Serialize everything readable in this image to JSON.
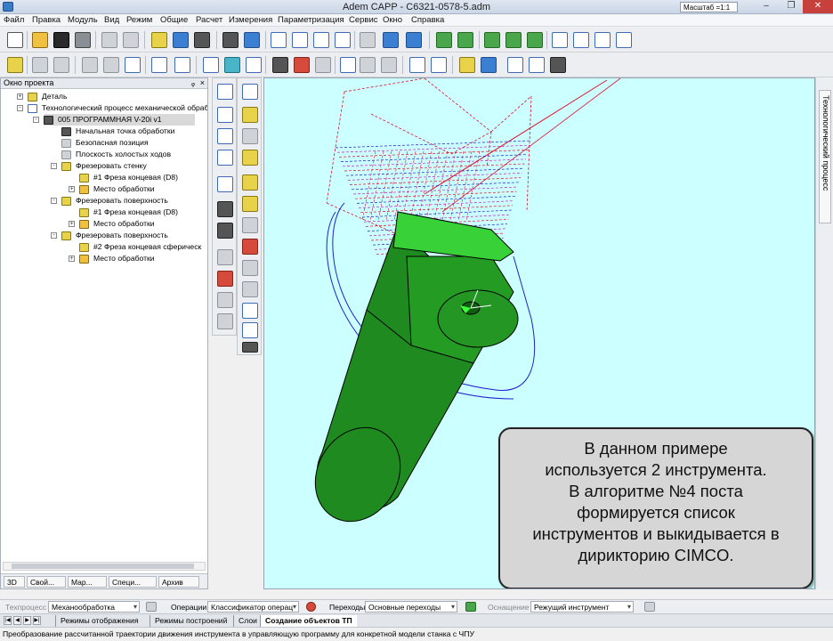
{
  "window": {
    "title": "Adem CAPP - C6321-0578-5.adm",
    "scale_label": "Масштаб =1:1",
    "minimize": "–",
    "maximize": "❐",
    "close": "✕"
  },
  "menu": [
    "Файл",
    "Правка",
    "Модуль",
    "Вид",
    "Режим",
    "Общие",
    "Расчет",
    "Измерения",
    "Параметризация",
    "Сервис",
    "Окно",
    "Справка"
  ],
  "project": {
    "header": "Окно проекта",
    "pin": "ᵩ",
    "close": "×",
    "tree": [
      {
        "label": "Деталь",
        "level": 0,
        "expander": "+"
      },
      {
        "label": "Технологический процесс механической обработ",
        "level": 0,
        "expander": "-"
      },
      {
        "label": "005  ПРОГРАММНАЯ V-20i v1",
        "level": 1,
        "expander": "-",
        "selected": true
      },
      {
        "label": "Начальная точка обработки",
        "level": 2
      },
      {
        "label": "Безопасная позиция",
        "level": 2
      },
      {
        "label": "Плоскость холостых ходов",
        "level": 2
      },
      {
        "label": "Фрезеровать стенку",
        "level": 2,
        "expander": "-"
      },
      {
        "label": "#1 Фреза концевая (D8)",
        "level": 3
      },
      {
        "label": "Место обработки",
        "level": 3,
        "expander": "+"
      },
      {
        "label": "Фрезеровать поверхность",
        "level": 2,
        "expander": "-"
      },
      {
        "label": "#1 Фреза концевая (D8)",
        "level": 3
      },
      {
        "label": "Место обработки",
        "level": 3,
        "expander": "+"
      },
      {
        "label": "Фрезеровать поверхность",
        "level": 2,
        "expander": "-"
      },
      {
        "label": "#2 Фреза концевая сферическ",
        "level": 3
      },
      {
        "label": "Место обработки",
        "level": 3,
        "expander": "+"
      }
    ],
    "tabs": [
      "3D",
      "Свой...",
      "Мар...",
      "Специ...",
      "Архив"
    ]
  },
  "note_lines": [
    "В данном примере",
    "используется 2 инструмента.",
    "В алгоритме №4 поста",
    "формируется  список",
    "инструментов и выкидывается в",
    "дирикторию CIMCO."
  ],
  "right_tab": "Технологический процесс",
  "options_bar": {
    "process_label": "Техпроцесс",
    "process_value": "Механообработка",
    "operations_label": "Операции",
    "operations_value": "Классификатор операц",
    "transitions_label": "Переходы",
    "transitions_value": "Основные переходы",
    "equipment_label": "Оснащение",
    "equipment_value": "Режущий инструмент"
  },
  "bottom_tabs": {
    "nav": [
      "|◀",
      "◀",
      "▶",
      "▶|"
    ],
    "tabs": [
      "Режимы отображения",
      "Режимы построений",
      "Слои",
      "Создание объектов ТП"
    ]
  },
  "status": "Преобразование рассчитанной траектории движения инструмента в управляющую программу для конкретной модели станка с ЧПУ",
  "colors": {
    "viewport_bg": "#ccffff",
    "part": "#1f8a1f",
    "part_light": "#33b833",
    "path_red": "#e0102a",
    "path_blue": "#2020d0",
    "path_magenta": "#c020c0",
    "note_bg": "#d6d6d6"
  }
}
